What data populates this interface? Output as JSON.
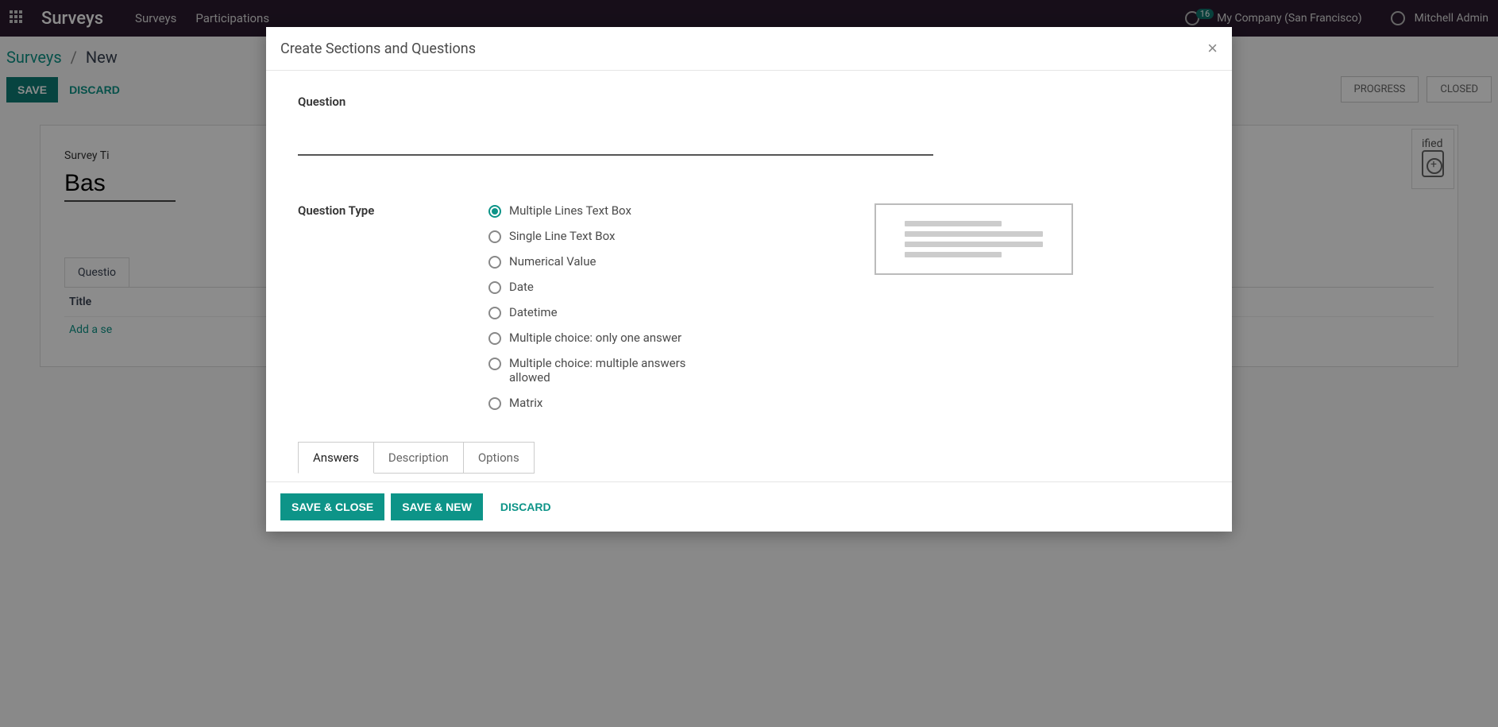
{
  "topbar": {
    "app_title": "Surveys",
    "nav": [
      "Surveys",
      "Participations"
    ],
    "badge": "16",
    "company": "My Company (San Francisco)",
    "user": "Mitchell Admin"
  },
  "breadcrumb": {
    "root": "Surveys",
    "current": "New"
  },
  "actions": {
    "save": "SAVE",
    "discard": "DISCARD"
  },
  "status": {
    "progress": "PROGRESS",
    "closed": "CLOSED"
  },
  "form": {
    "stat_label": "ified",
    "survey_label": "Survey Ti",
    "survey_title_value": "Bas",
    "tab_label": "Questio",
    "col_title": "Title",
    "add_link": "Add a se"
  },
  "modal": {
    "title": "Create Sections and Questions",
    "question_label": "Question",
    "question_value": "",
    "type_label": "Question Type",
    "types": [
      "Multiple Lines Text Box",
      "Single Line Text Box",
      "Numerical Value",
      "Date",
      "Datetime",
      "Multiple choice: only one answer",
      "Multiple choice: multiple answers allowed",
      "Matrix"
    ],
    "selected_type_index": 0,
    "tabs": [
      "Answers",
      "Description",
      "Options"
    ],
    "active_tab_index": 0,
    "footer": {
      "save_close": "SAVE & CLOSE",
      "save_new": "SAVE & NEW",
      "discard": "DISCARD"
    }
  }
}
